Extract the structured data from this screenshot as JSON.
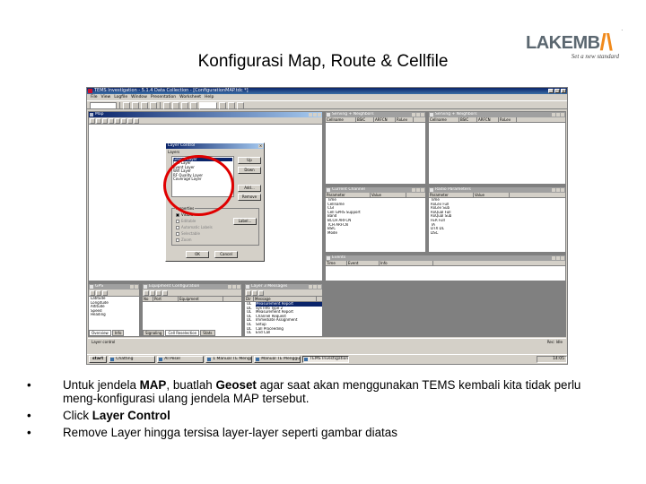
{
  "slide": {
    "title": "Konfigurasi Map, Route & Cellfile"
  },
  "logo": {
    "word": "LAKEMB",
    "tagline": "Set a new standard",
    "dot": "."
  },
  "app": {
    "title": "TEMS Investigation - 5.1.4 Data Collection - [ConfigurationMAP.tdc *]",
    "menu": [
      "File",
      "View",
      "Logfile",
      "Window",
      "Presentation",
      "Worksheet",
      "Help"
    ]
  },
  "windows": {
    "map_title": "Map",
    "serving1_title": "Serving + Neighbors",
    "serving2_title": "Serving + Neighbors",
    "serving1_cols": [
      "Cellname",
      "BSIC",
      "ARFCN",
      "RxLev"
    ],
    "serving2_cols": [
      "Cellname",
      "BSIC",
      "ARFCN",
      "RxLev"
    ],
    "current_channel_title": "Current Channel",
    "current_channel_cols": [
      "Parameter",
      "Value"
    ],
    "current_channel_rows": [
      "Time",
      "Cellname",
      "CGI",
      "Cell GPRS Support",
      "Band",
      "BCCH ARFCN",
      "TCH ARFCN",
      "BSIC",
      "Mode"
    ],
    "mode_title": "Radio Parameters",
    "mode_cols": [
      "Parameter",
      "Value"
    ],
    "mode_rows": [
      "Time",
      "RxLev Full",
      "RxLev Sub",
      "RxQual Full",
      "RxQual Sub",
      "FER Full",
      "TA",
      "DTX DL",
      "DSC"
    ],
    "events_title": "Events",
    "events_cols": [
      "Time",
      "Event",
      "Info"
    ],
    "gps_title": "GPS",
    "gps_rows": [
      "Latitude",
      "Longitude",
      "Altitude",
      "Speed",
      "Heading"
    ],
    "layer3_title": "Layer 3 Messages",
    "layer3_cols": [
      "Dir",
      "Message"
    ],
    "layer3_rows": [
      "Measurement Report",
      "Sys Info Type 2",
      "Measurement Report",
      "Channel Request",
      "Immediate Assignment",
      "Setup",
      "Call Proceeding",
      "End Call",
      "Disconnect"
    ],
    "layer3_dirs": [
      "UL",
      "DL",
      "UL",
      "UL",
      "DL",
      "UL",
      "DL",
      "UL",
      "DL"
    ],
    "equip_title": "Equipment Configuration",
    "equip_cols": [
      "No",
      "Port",
      "Equipment"
    ]
  },
  "dialog": {
    "title": "Layer Control",
    "list_label": "Layers",
    "layers": [
      "Geoset Layer",
      "Cell Layer",
      "Event Layer",
      "Wifi Layer",
      "RF Quality Layer",
      "Coverage Layer"
    ],
    "buttons": {
      "up": "Up",
      "down": "Down",
      "add": "Add...",
      "remove": "Remove",
      "labels": "Label...",
      "ok": "OK",
      "cancel": "Cancel"
    },
    "group_label": "Properties",
    "checks": [
      "Visible",
      "Editable",
      "Automatic Labels",
      "Selectable",
      "Zoom"
    ]
  },
  "bottom_tabs": [
    "Overview",
    "Info",
    "Signaling",
    "Cell Reselection",
    "Stats"
  ],
  "status": {
    "left": "Layer control",
    "right": "Rec: Idle"
  },
  "taskbar": {
    "start": "start",
    "items": [
      "Chatting",
      "AI Pesel",
      "1 Manual TE Menggunu...",
      "Manual TE Menggunu...",
      "TEMS Investigation..."
    ],
    "active_index": 4,
    "clock": "14:05"
  },
  "bullets": [
    {
      "parts": [
        "Untuk jendela ",
        "MAP",
        ", buatlah ",
        "Geoset",
        " agar saat akan menggunakan TEMS kembali kita tidak perlu meng-konfigurasi ulang jendela MAP tersebut."
      ]
    },
    {
      "parts": [
        "Click ",
        "Layer Control"
      ]
    },
    {
      "parts": [
        "Remove Layer hingga tersisa layer-layer seperti gambar diatas"
      ]
    }
  ],
  "bullet_char": "•"
}
